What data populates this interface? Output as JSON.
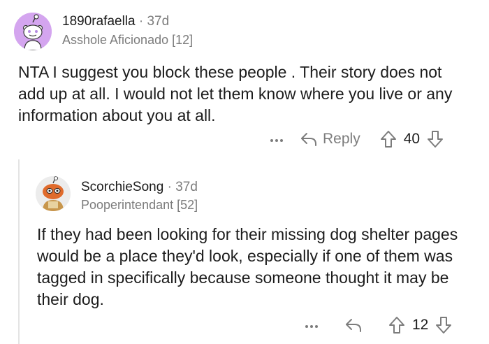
{
  "comment": {
    "username": "1890rafaella",
    "age": "37d",
    "flair": "Asshole Aficionado [12]",
    "body": "NTA   I suggest you block these people .  Their story does not add up at all.  I would not let them know where you live or any information about you at all.",
    "reply_label": "Reply",
    "score": "40",
    "more_icon": "more-dots-icon",
    "reply_icon": "reply-arrow-icon",
    "upvote_icon": "upvote-arrow-icon",
    "downvote_icon": "downvote-arrow-icon"
  },
  "reply": {
    "username": "ScorchieSong",
    "age": "37d",
    "flair": "Pooperintendant [52]",
    "body": "If they had been looking for their missing dog shelter pages would be a place they'd look, especially if one of them was tagged in specifically because someone thought it may be their dog.",
    "score": "12"
  },
  "colors": {
    "avatar1_bg": "#d4a5ef",
    "text": "#1c1c1c",
    "meta": "#7c7c7c"
  }
}
